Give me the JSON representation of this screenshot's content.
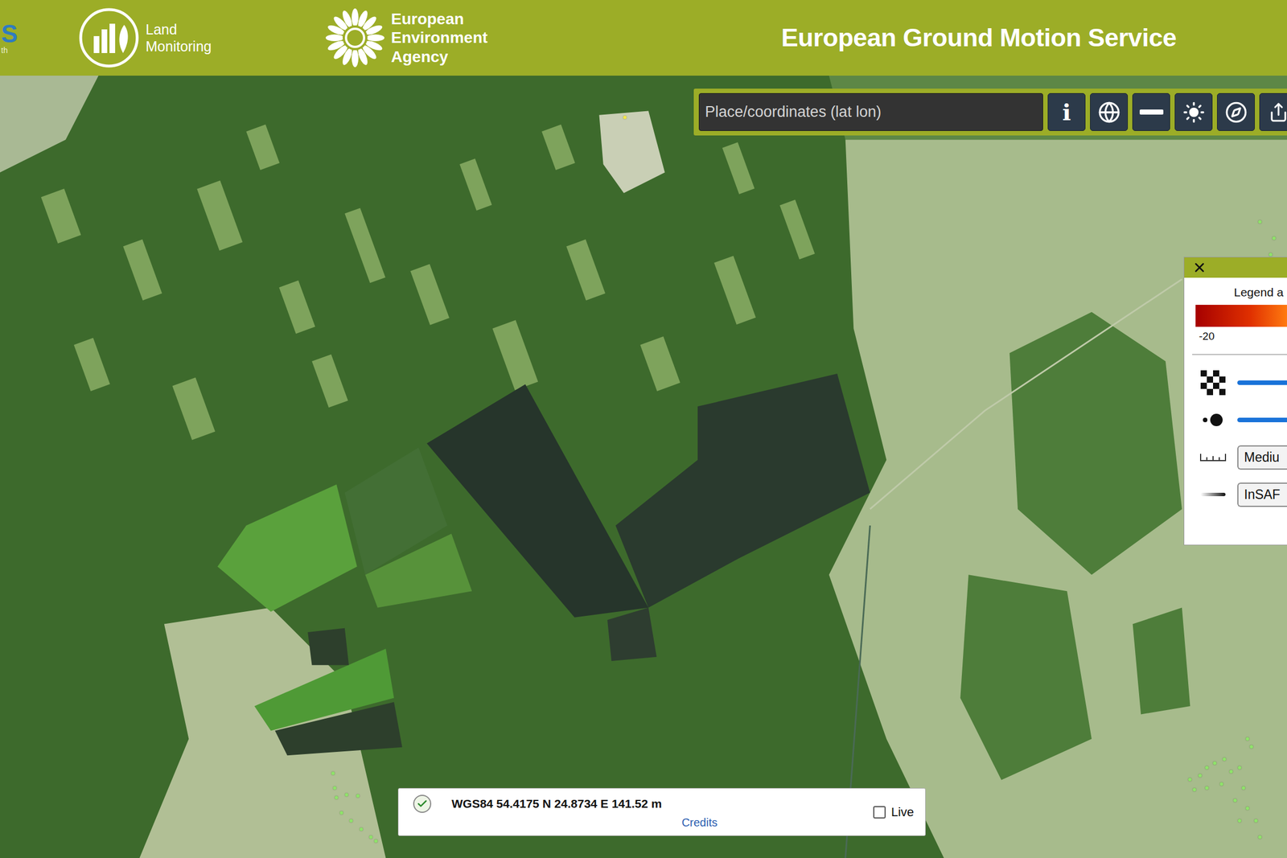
{
  "header": {
    "brand_fragment": "S",
    "brand_fragment_sub": "th",
    "land_monitoring": [
      "Land",
      "Monitoring"
    ],
    "agency": [
      "European",
      "Environment",
      "Agency"
    ],
    "title": "European Ground Motion Service"
  },
  "toolbar": {
    "search_placeholder": "Place/coordinates (lat lon)",
    "buttons": [
      {
        "kind": "info",
        "label": "i"
      },
      {
        "kind": "globe",
        "label": ""
      },
      {
        "kind": "ruler",
        "label": ""
      },
      {
        "kind": "sun",
        "label": ""
      },
      {
        "kind": "compass",
        "label": ""
      },
      {
        "kind": "share",
        "label": ""
      }
    ]
  },
  "legend": {
    "title": "Legend a",
    "scale_min": "-20",
    "rows": [
      {
        "kind": "slider",
        "icon": "checker",
        "level": 0.9
      },
      {
        "kind": "slider",
        "icon": "dots",
        "level": 0.9
      },
      {
        "kind": "dropdown",
        "icon": "ruler",
        "value": "Mediu"
      },
      {
        "kind": "dropdown",
        "icon": "line",
        "value": "InSAF"
      }
    ]
  },
  "coordinates": {
    "text": "WGS84 54.4175 N 24.8734 E 141.52 m",
    "credits": "Credits",
    "live": {
      "label": "Live",
      "checked": false
    }
  },
  "map_points": [
    {
      "color": "#f2e84a"
    },
    {
      "color": "#8fe36a"
    },
    {
      "color": "#8fe36a"
    },
    {
      "color": "#8fe36a"
    },
    {
      "color": "#8fe36a"
    },
    {
      "color": "#8fe36a"
    },
    {
      "color": "#8fe36a"
    },
    {
      "color": "#8fe36a"
    },
    {
      "color": "#8fe36a"
    },
    {
      "color": "#8fe36a"
    },
    {
      "color": "#8fe36a"
    },
    {
      "color": "#8fe36a"
    },
    {
      "color": "#8fe36a"
    },
    {
      "color": "#8fe36a"
    },
    {
      "color": "#8fe36a"
    },
    {
      "color": "#8fe36a"
    },
    {
      "color": "#8fe36a"
    },
    {
      "color": "#8fe36a"
    },
    {
      "color": "#8fe36a"
    },
    {
      "color": "#8fe36a"
    },
    {
      "color": "#8fe36a"
    },
    {
      "color": "#8fe36a"
    },
    {
      "color": "#8fe36a"
    },
    {
      "color": "#8fe36a"
    },
    {
      "color": "#8fe36a"
    },
    {
      "color": "#8fe36a"
    },
    {
      "color": "#8fe36a"
    },
    {
      "color": "#8fe36a"
    },
    {
      "color": "#8fe36a"
    },
    {
      "color": "#8fe36a"
    },
    {
      "color": "#8fe36a"
    },
    {
      "color": "#8fe36a"
    }
  ]
}
